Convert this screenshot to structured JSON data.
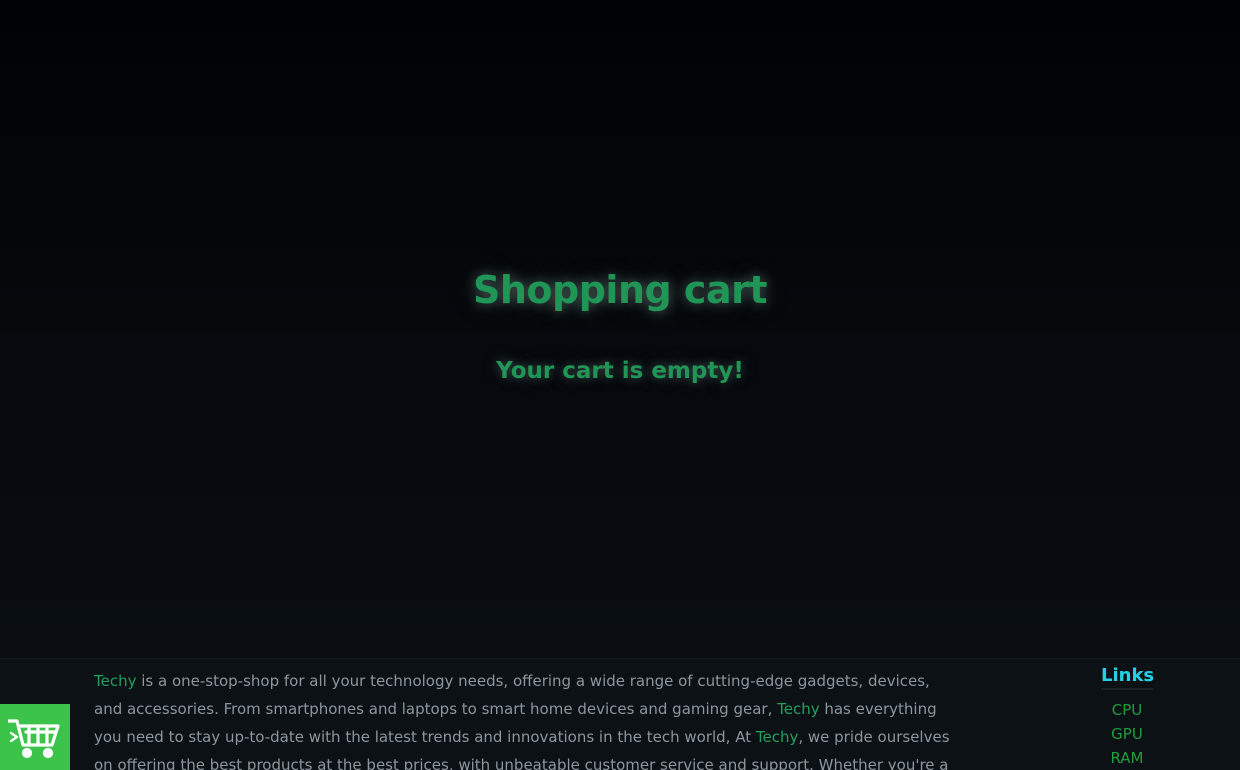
{
  "cart": {
    "title": "Shopping cart",
    "empty_message": "Your cart is empty!"
  },
  "footer": {
    "about": {
      "brand": "Techy",
      "part1": " is a one-stop-shop for all your technology needs, offering a wide range of cutting-edge gadgets, devices, and accessories. From smartphones and laptops to smart home devices and gaming gear, ",
      "part2": " has everything you need to stay up-to-date with the latest trends and innovations in the tech world, At ",
      "part3": ", we pride ourselves on offering the best products at the best prices, with unbeatable customer service and support. Whether you're a tech enthusiast or a casual"
    },
    "links": {
      "title": "Links",
      "items": [
        "CPU",
        "GPU",
        "RAM"
      ]
    }
  },
  "cart_button": {
    "icon": "shopping-cart-icon"
  },
  "colors": {
    "accent_green": "#1f9656",
    "link_green": "#1f9f3a",
    "links_title": "#22d3e6",
    "cart_button_bg": "#3cc44a",
    "footer_bg": "#0c1116"
  }
}
